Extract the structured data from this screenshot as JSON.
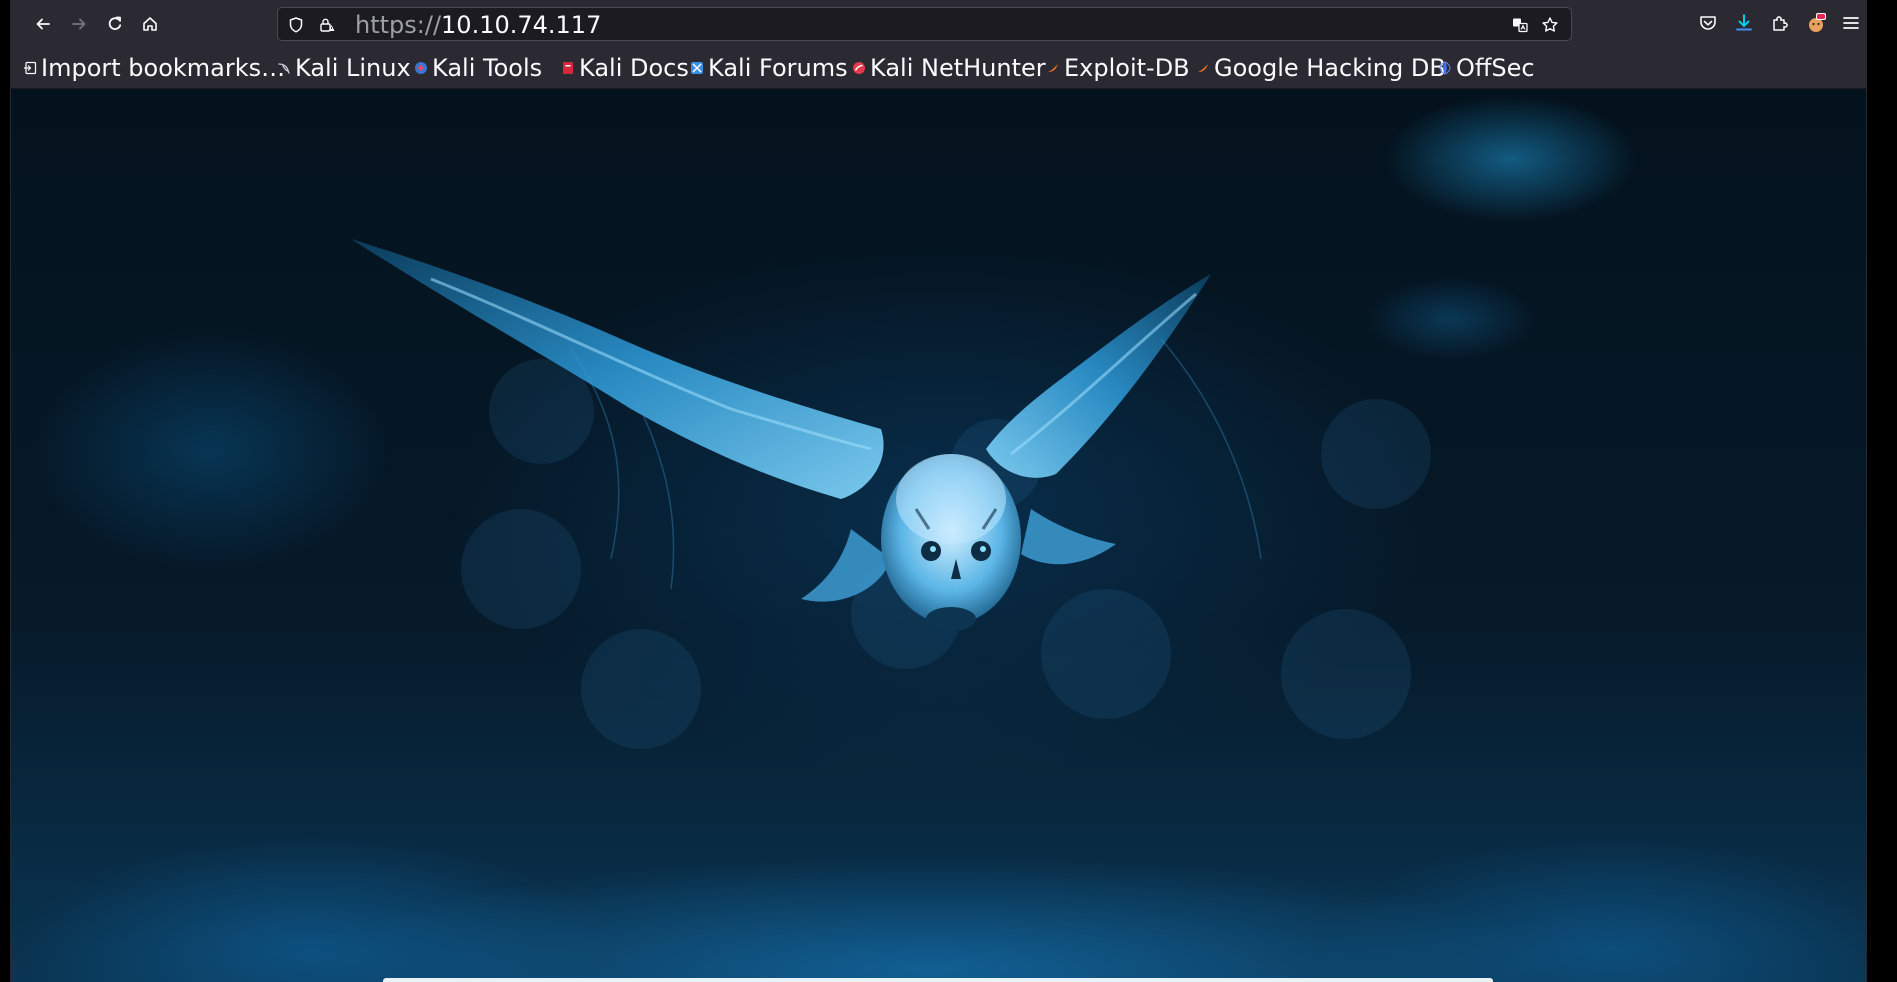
{
  "browser": {
    "url_scheme": "https://",
    "url_host": "10.10.74.117",
    "icons": {
      "back": "arrow-left-icon",
      "forward": "arrow-right-icon",
      "reload": "reload-icon",
      "home": "home-icon",
      "tracking_protection": "shield-icon",
      "connection": "lock-warning-icon",
      "translate": "translate-icon",
      "bookmark_star": "star-icon",
      "pocket": "pocket-icon",
      "downloads": "download-icon",
      "extensions": "puzzle-icon",
      "profile": "fox-account-icon",
      "menu": "hamburger-menu-icon"
    }
  },
  "bookmarks": [
    {
      "label": "Import bookmarks…",
      "icon": "import-icon"
    },
    {
      "label": "Kali Linux",
      "icon": "kali-dragon-icon"
    },
    {
      "label": "Kali Tools",
      "icon": "kali-tools-icon"
    },
    {
      "label": "Kali Docs",
      "icon": "kali-docs-icon"
    },
    {
      "label": "Kali Forums",
      "icon": "kali-forums-icon"
    },
    {
      "label": "Kali NetHunter",
      "icon": "nethunter-icon"
    },
    {
      "label": "Exploit-DB",
      "icon": "exploit-db-icon"
    },
    {
      "label": "Google Hacking DB",
      "icon": "ghdb-icon"
    },
    {
      "label": "OffSec",
      "icon": "offsec-icon"
    }
  ],
  "page": {
    "background_image": "flying-owl-photo",
    "accent_color": "#1b8fd0"
  }
}
